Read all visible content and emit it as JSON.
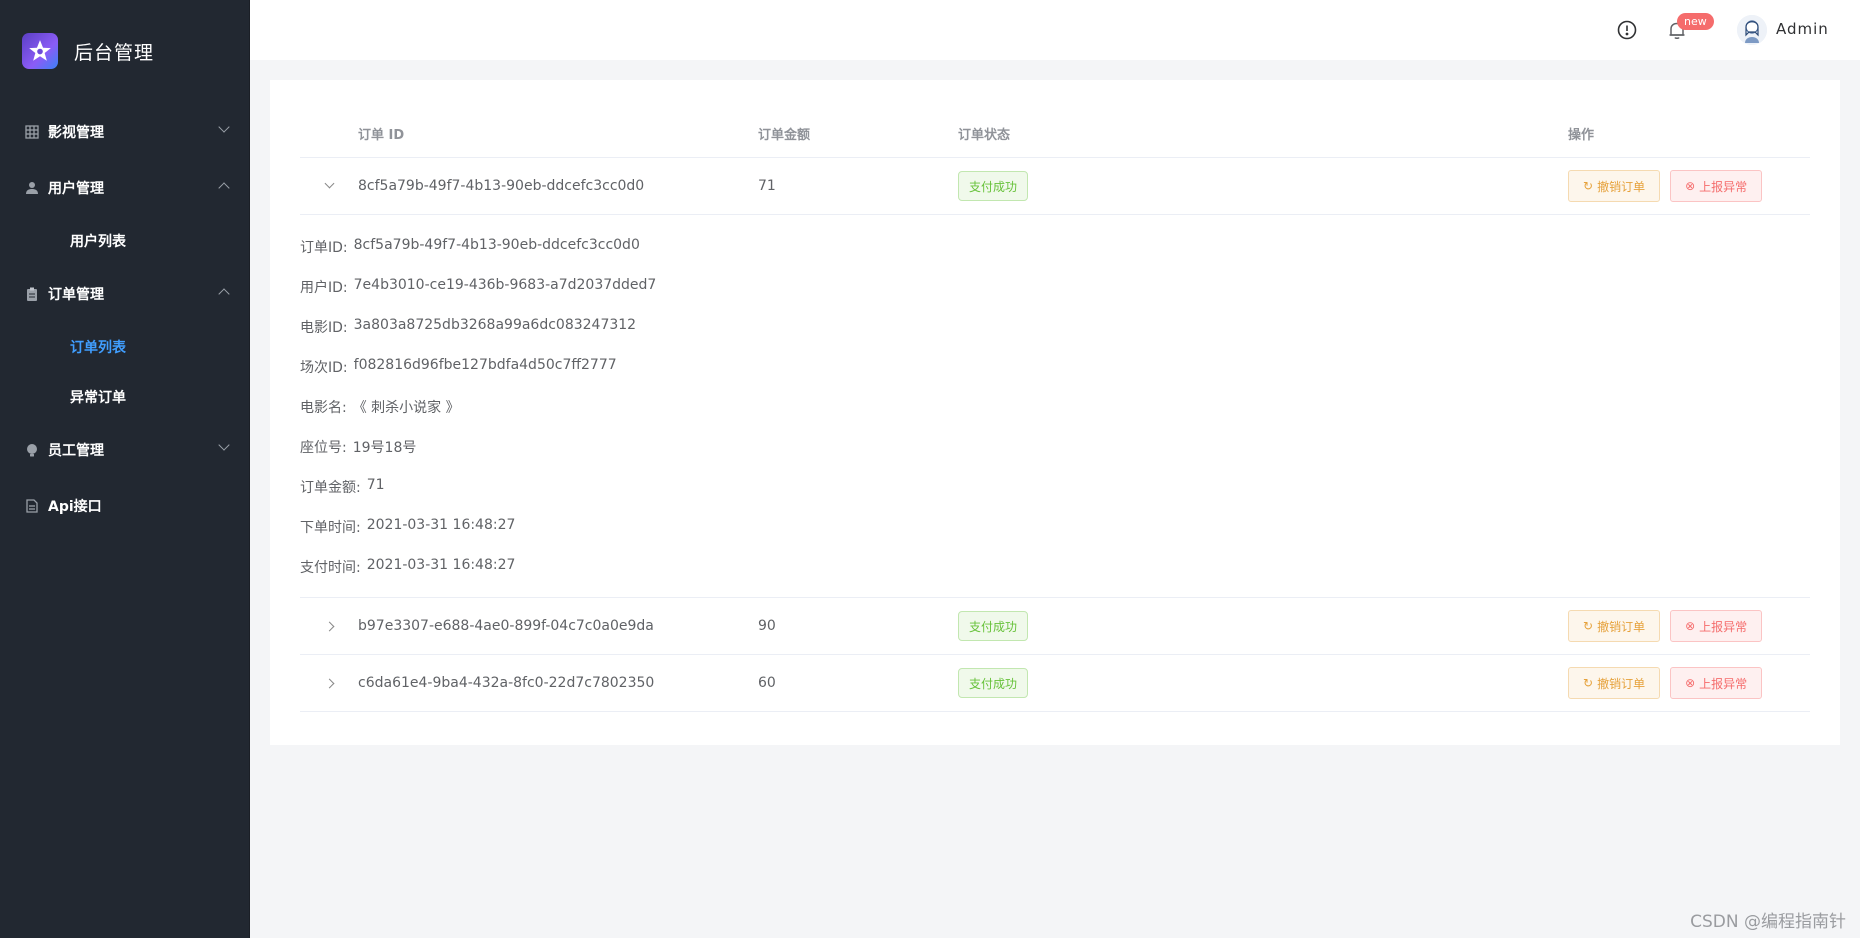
{
  "app": {
    "title": "后台管理"
  },
  "sidebar": {
    "groups": [
      {
        "label": "影视管理",
        "icon": "grid-icon",
        "expanded": false,
        "items": []
      },
      {
        "label": "用户管理",
        "icon": "user-icon",
        "expanded": true,
        "items": [
          {
            "label": "用户列表",
            "active": false
          }
        ]
      },
      {
        "label": "订单管理",
        "icon": "clipboard-icon",
        "expanded": true,
        "items": [
          {
            "label": "订单列表",
            "active": true
          },
          {
            "label": "异常订单",
            "active": false
          }
        ]
      },
      {
        "label": "员工管理",
        "icon": "bulb-icon",
        "expanded": false,
        "items": []
      },
      {
        "label": "Api接口",
        "icon": "document-icon",
        "expanded": false,
        "items": []
      }
    ]
  },
  "header": {
    "notification_badge": "new",
    "user_name": "Admin"
  },
  "table": {
    "columns": {
      "id": "订单 ID",
      "amount": "订单金额",
      "status": "订单状态",
      "ops": "操作"
    },
    "rows": [
      {
        "id": "8cf5a79b-49f7-4b13-90eb-ddcefc3cc0d0",
        "amount": "71",
        "status": "支付成功",
        "expanded": true
      },
      {
        "id": "b97e3307-e688-4ae0-899f-04c7c0a0e9da",
        "amount": "90",
        "status": "支付成功",
        "expanded": false
      },
      {
        "id": "c6da61e4-9ba4-432a-8fc0-22d7c7802350",
        "amount": "60",
        "status": "支付成功",
        "expanded": false
      }
    ],
    "cancel_label": "撤销订单",
    "report_label": "上报异常"
  },
  "detail": [
    {
      "key": "订单ID:",
      "value": "8cf5a79b-49f7-4b13-90eb-ddcefc3cc0d0"
    },
    {
      "key": "用户ID:",
      "value": "7e4b3010-ce19-436b-9683-a7d2037dded7"
    },
    {
      "key": "电影ID:",
      "value": "3a803a8725db3268a99a6dc083247312"
    },
    {
      "key": "场次ID:",
      "value": "f082816d96fbe127bdfa4d50c7ff2777"
    },
    {
      "key": "电影名:",
      "value": "《 刺杀小说家 》"
    },
    {
      "key": "座位号:",
      "value": "19号18号"
    },
    {
      "key": "订单金额:",
      "value": "71"
    },
    {
      "key": "下单时间:",
      "value": "2021-03-31 16:48:27"
    },
    {
      "key": "支付时间:",
      "value": "2021-03-31 16:48:27"
    }
  ],
  "watermark": "CSDN @编程指南针",
  "colors": {
    "sidebar_bg": "#222831",
    "accent": "#409eff",
    "success": "#67c23a",
    "warning": "#e6a23c",
    "danger": "#f56c6c"
  }
}
